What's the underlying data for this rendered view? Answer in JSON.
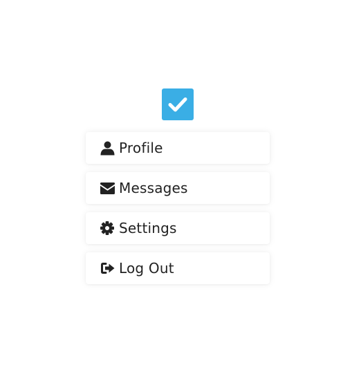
{
  "checkbox": {
    "checked": true,
    "icon": "check-icon",
    "color": "#3aaee5"
  },
  "menu": {
    "items": [
      {
        "label": "Profile",
        "icon": "user-icon"
      },
      {
        "label": "Messages",
        "icon": "envelope-icon"
      },
      {
        "label": "Settings",
        "icon": "gear-icon"
      },
      {
        "label": "Log Out",
        "icon": "sign-out-icon"
      }
    ]
  },
  "colors": {
    "text": "#222222",
    "icon": "#222222",
    "background": "#ffffff"
  }
}
